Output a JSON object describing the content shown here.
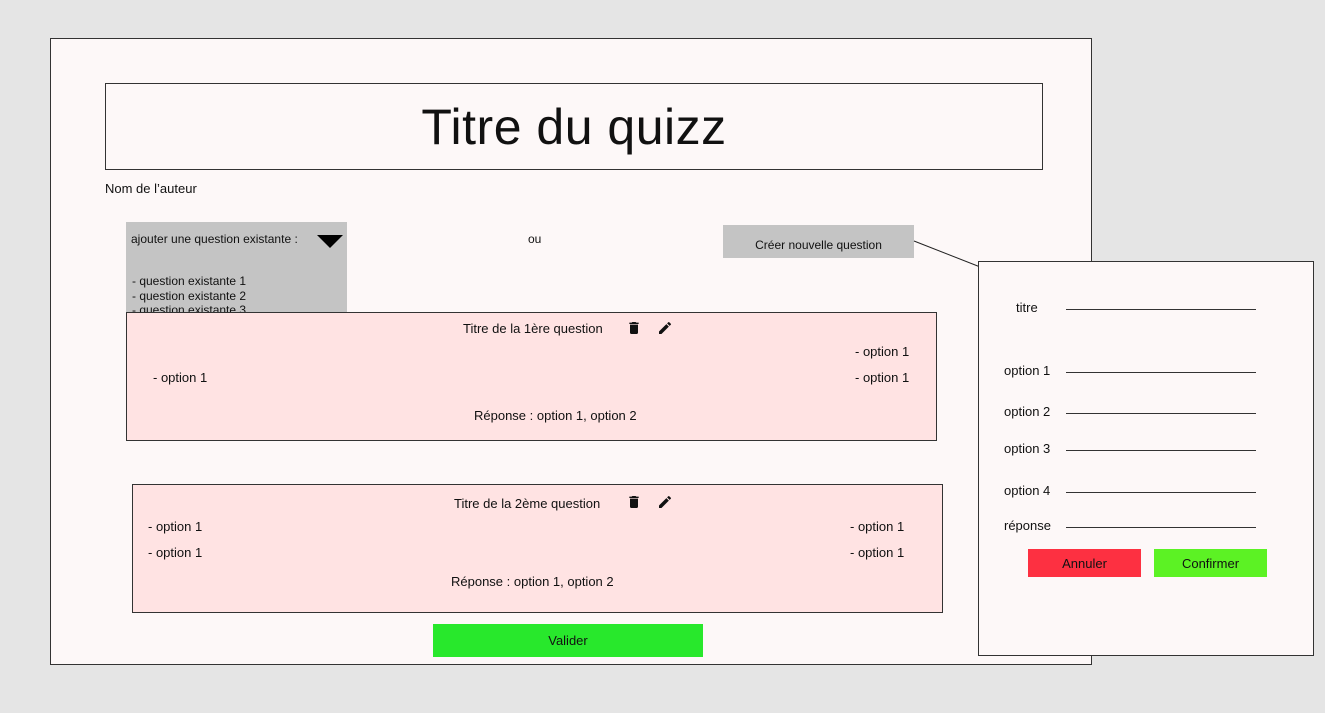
{
  "quiz": {
    "title": "Titre du quizz",
    "author": "Nom de l’auteur"
  },
  "add_existing": {
    "label": "ajouter une question existante :",
    "options": [
      "- question existante 1",
      "- question existante 2",
      "- question existante 3",
      "- ...."
    ]
  },
  "or_label": "ou",
  "create_button": "Créer nouvelle question",
  "questions": [
    {
      "title": "Titre de la 1ère question",
      "left_options": [
        "- option 1"
      ],
      "right_options": [
        "- option 1",
        "- option 1"
      ],
      "answer": "Réponse : option 1, option 2"
    },
    {
      "title": "Titre de la 2ème question",
      "left_options": [
        "- option 1",
        "- option 1"
      ],
      "right_options": [
        "- option 1",
        "- option 1"
      ],
      "answer": "Réponse : option 1, option 2"
    }
  ],
  "icons": {
    "delete": "trash-icon",
    "edit": "pencil-icon"
  },
  "validate_button": "Valider",
  "new_question_form": {
    "fields": [
      {
        "label": "titre",
        "value": ""
      },
      {
        "label": "option 1",
        "value": ""
      },
      {
        "label": "option 2",
        "value": ""
      },
      {
        "label": "option 3",
        "value": ""
      },
      {
        "label": "option 4",
        "value": ""
      },
      {
        "label": "réponse",
        "value": ""
      }
    ],
    "cancel_button": "Annuler",
    "confirm_button": "Confirmer"
  },
  "colors": {
    "background": "#e5e5e5",
    "page": "#fdf8f8",
    "question_card": "#ffe3e3",
    "gray_control": "#c4c4c4",
    "validate": "#28e82c",
    "cancel": "#fd3041",
    "confirm": "#5cf224"
  }
}
